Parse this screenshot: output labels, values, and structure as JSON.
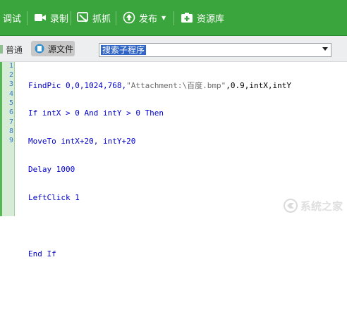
{
  "toolbar": {
    "items": [
      {
        "label": "调试",
        "icon": "debug-icon"
      },
      {
        "label": "录制",
        "icon": "camera-icon"
      },
      {
        "label": "抓抓",
        "icon": "capture-icon"
      },
      {
        "label": "发布",
        "icon": "publish-icon"
      },
      {
        "label": "资源库",
        "icon": "plus-box-icon"
      }
    ],
    "bg_color": "#3aa53c"
  },
  "subbar": {
    "mode_normal": "普通",
    "mode_source": "源文件",
    "dropdown_value": "搜索子程序"
  },
  "editor": {
    "line_numbers": [
      "1",
      "2",
      "3",
      "4",
      "5",
      "6",
      "7",
      "8",
      "9"
    ],
    "lines": [
      "FindPic 0,0,1024,768,\"Attachment:\\百度.bmp\",0.9,intX,intY",
      "If intX > 0 And intY > 0 Then",
      "MoveTo intX+20, intY+20",
      "Delay 1000",
      "LeftClick 1",
      "",
      "End If",
      "",
      ""
    ]
  },
  "watermark": {
    "text": "系统之家"
  }
}
